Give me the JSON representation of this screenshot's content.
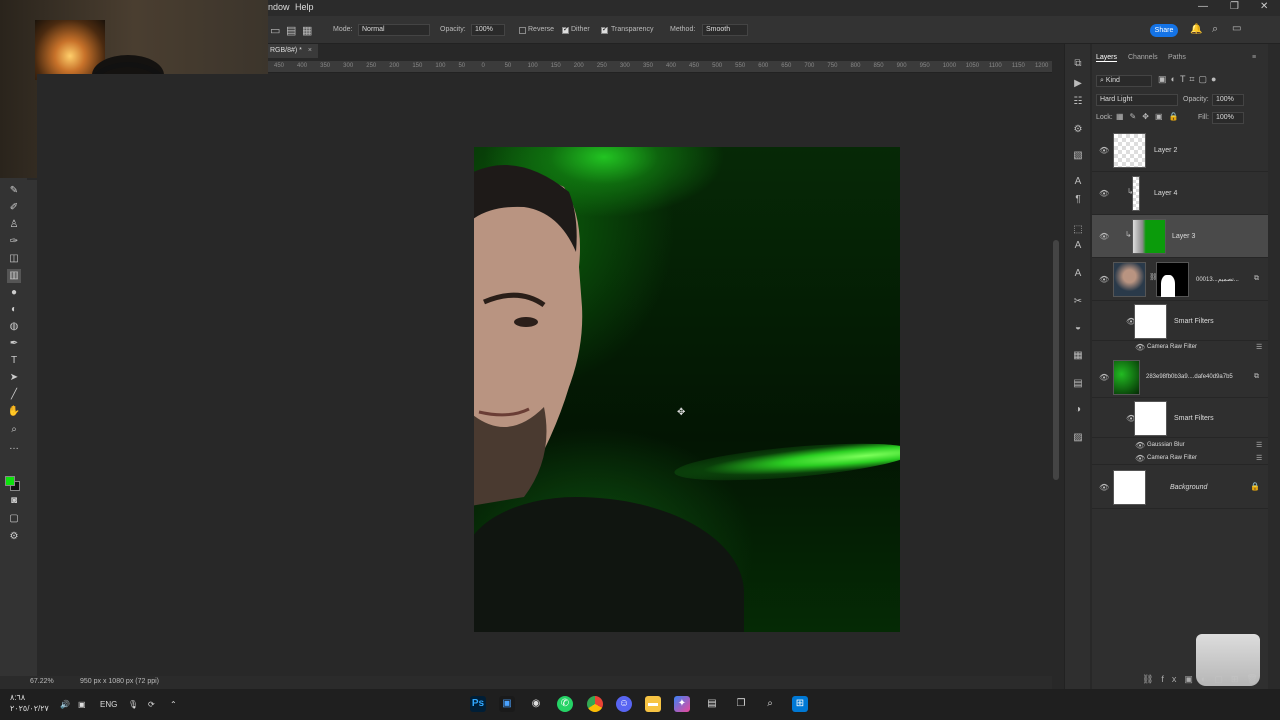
{
  "menu": {
    "window": "ndow",
    "help": "Help"
  },
  "window_controls": {
    "minimize": "—",
    "restore": "❐",
    "close": "✕"
  },
  "options": {
    "mode_label": "Mode:",
    "mode_value": "Normal",
    "opacity_label": "Opacity:",
    "opacity_value": "100%",
    "reverse": "Reverse",
    "dither": "Dither",
    "transparency": "Transparency",
    "method_label": "Method:",
    "method_value": "Smooth",
    "share": "Share"
  },
  "document": {
    "tab_title": "RGB/8#) *",
    "zoom": "67.22%",
    "info": "950 px x 1080 px (72 ppi)"
  },
  "ruler_ticks": [
    "450",
    "400",
    "350",
    "300",
    "250",
    "200",
    "150",
    "100",
    "50",
    "0",
    "50",
    "100",
    "150",
    "200",
    "250",
    "300",
    "350",
    "400",
    "450",
    "500",
    "550",
    "600",
    "650",
    "700",
    "750",
    "800",
    "850",
    "900",
    "950",
    "1000",
    "1050",
    "1100",
    "1150",
    "1200"
  ],
  "panel": {
    "tabs": [
      "Layers",
      "Channels",
      "Paths"
    ],
    "kind": "Kind",
    "blend_mode": "Hard Light",
    "opacity_label": "Opacity:",
    "opacity_value": "100%",
    "lock_label": "Lock:",
    "fill_label": "Fill:",
    "fill_value": "100%",
    "layers": [
      {
        "name": "Layer 2"
      },
      {
        "name": "Layer 4"
      },
      {
        "name": "Layer 3"
      },
      {
        "name": "00013...تصميم..."
      },
      {
        "name": "Smart Filters"
      },
      {
        "name": "Camera Raw Filter"
      },
      {
        "name": "283e98fb0b3a9....dafe40d9a7b5"
      },
      {
        "name": "Smart Filters"
      },
      {
        "name": "Gaussian Blur"
      },
      {
        "name": "Camera Raw Filter"
      },
      {
        "name": "Background"
      }
    ]
  },
  "taskbar": {
    "time": "٨:٦٨",
    "date": "٢٠٢٥/٠٢/٢٧",
    "lang": "ENG"
  },
  "colors": {
    "foreground": "#0de20d",
    "background": "#111111",
    "accent": "#1473e6"
  }
}
